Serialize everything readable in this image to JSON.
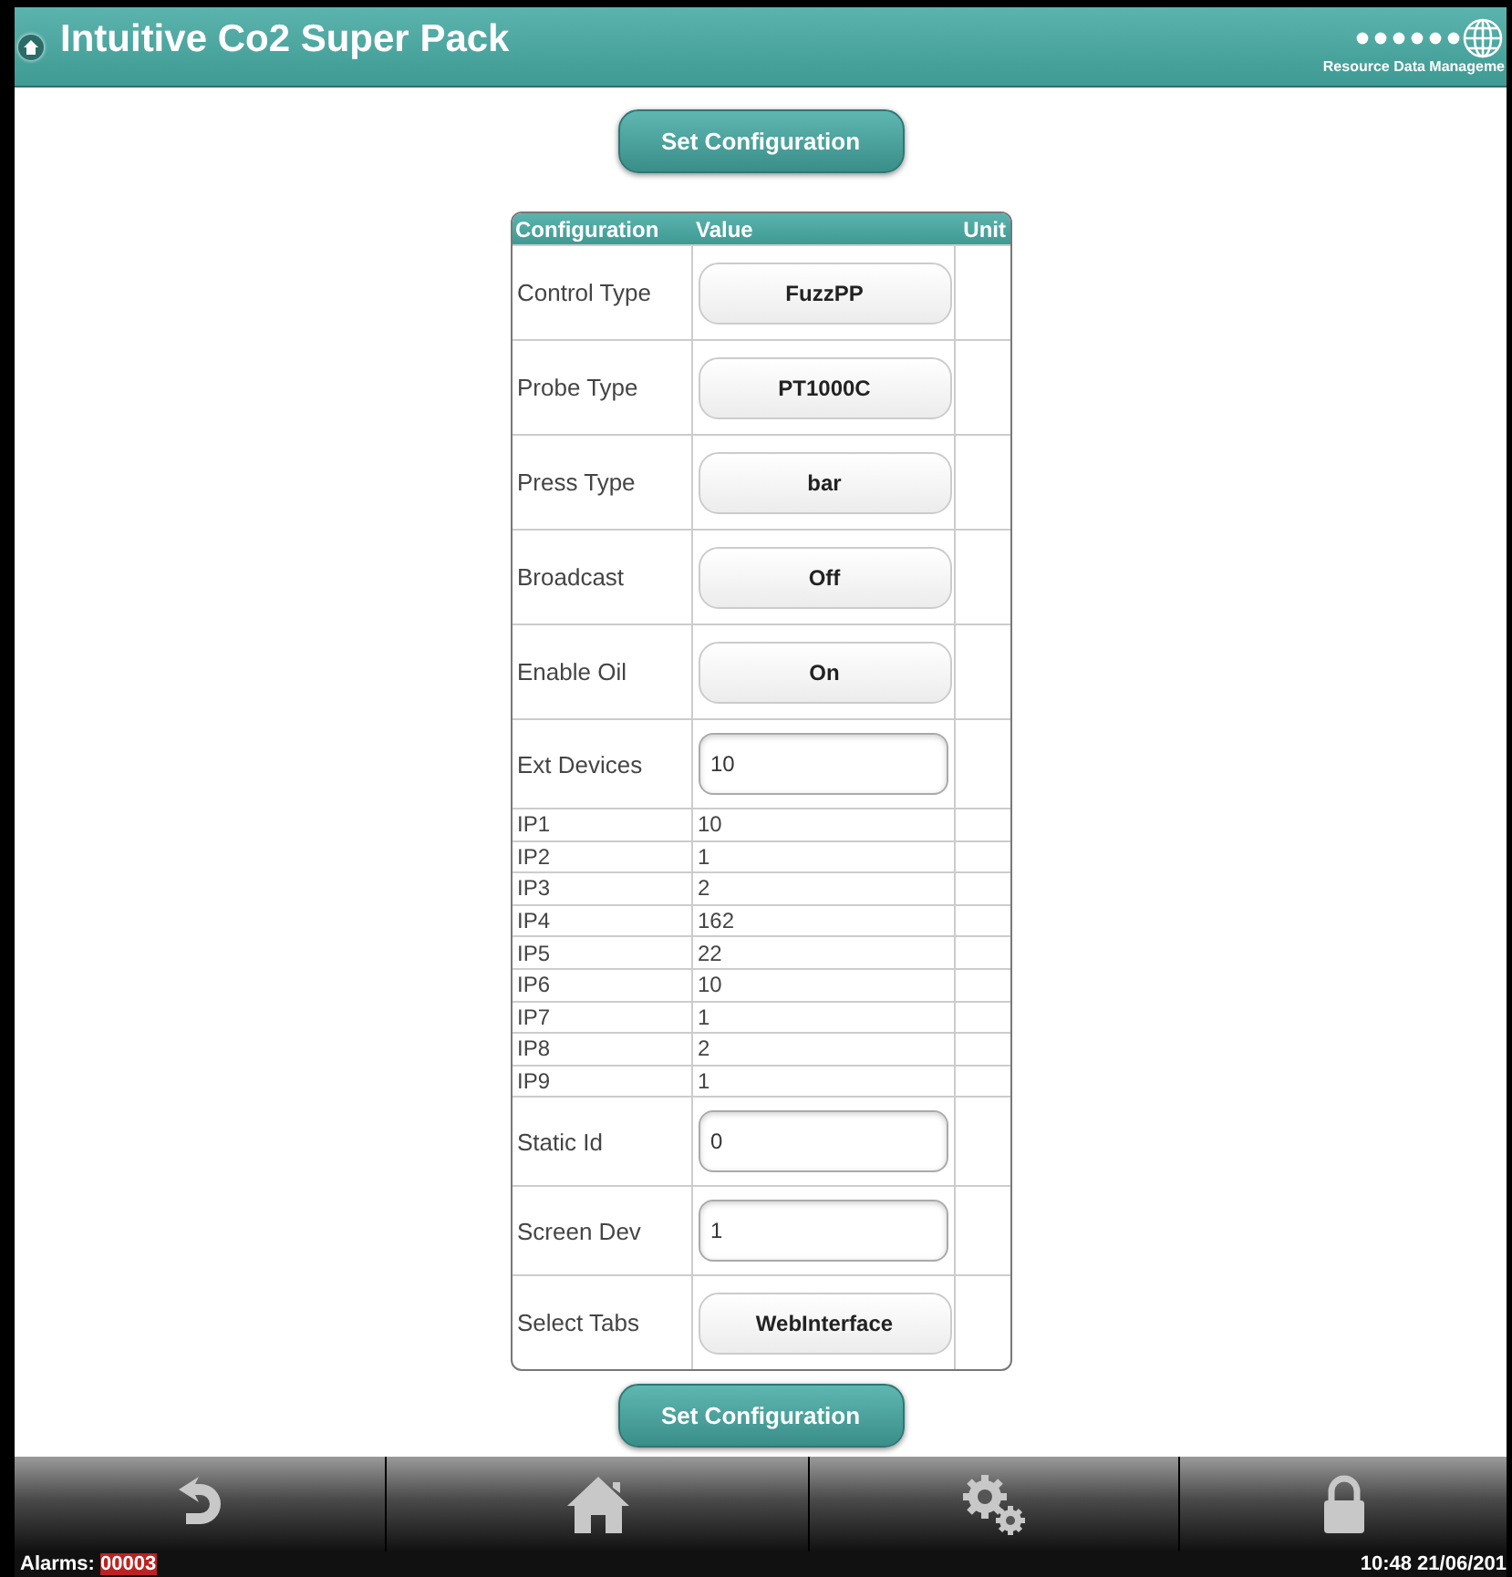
{
  "header": {
    "title": "Intuitive Co2 Super Pack",
    "logo_text": "Resource Data Manageme"
  },
  "top_button": "Set Configuration",
  "table": {
    "columns": [
      "Configuration",
      "Value",
      "Unit"
    ],
    "rows": [
      {
        "label": "Control Type",
        "kind": "button",
        "value": "FuzzPP"
      },
      {
        "label": "Probe Type",
        "kind": "button",
        "value": "PT1000C"
      },
      {
        "label": "Press Type",
        "kind": "button",
        "value": "bar"
      },
      {
        "label": "Broadcast",
        "kind": "button",
        "value": "Off"
      },
      {
        "label": "Enable Oil",
        "kind": "button",
        "value": "On"
      },
      {
        "label": "Ext Devices",
        "kind": "input",
        "value": "10"
      },
      {
        "label": "IP1",
        "kind": "text",
        "value": "10"
      },
      {
        "label": "IP2",
        "kind": "text",
        "value": "1"
      },
      {
        "label": "IP3",
        "kind": "text",
        "value": "2"
      },
      {
        "label": "IP4",
        "kind": "text",
        "value": "162"
      },
      {
        "label": "IP5",
        "kind": "text",
        "value": "22"
      },
      {
        "label": "IP6",
        "kind": "text",
        "value": "10"
      },
      {
        "label": "IP7",
        "kind": "text",
        "value": "1"
      },
      {
        "label": "IP8",
        "kind": "text",
        "value": "2"
      },
      {
        "label": "IP9",
        "kind": "text",
        "value": "1"
      },
      {
        "label": "Static Id",
        "kind": "input",
        "value": "0"
      },
      {
        "label": "Screen Dev",
        "kind": "input",
        "value": "1"
      },
      {
        "label": "Select Tabs",
        "kind": "button",
        "value": "WebInterface"
      }
    ]
  },
  "bottom_button": "Set Configuration",
  "status_bar": {
    "alarms_label": "Alarms:",
    "alarms_count": "00003",
    "datetime": "10:48 21/06/201"
  }
}
